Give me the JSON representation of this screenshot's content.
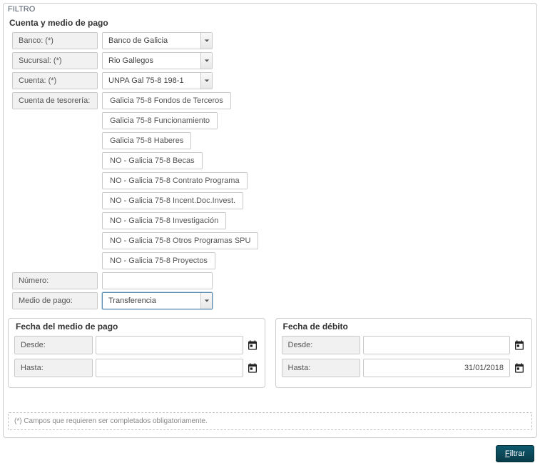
{
  "filter_title": "FILTRO",
  "sections": {
    "cuenta": {
      "title": "Cuenta y medio de pago",
      "banco_label": "Banco: (*)",
      "banco_value": "Banco de Galicia",
      "sucursal_label": "Sucursal: (*)",
      "sucursal_value": "Rio Gallegos",
      "cuenta_label": "Cuenta: (*)",
      "cuenta_value": "UNPA Gal 75-8 198-1",
      "tesoreria_label": "Cuenta de tesorería:",
      "tesoreria_items": [
        "Galicia 75-8 Fondos de Terceros",
        "Galicia 75-8 Funcionamiento",
        "Galicia 75-8 Haberes",
        "NO - Galicia 75-8 Becas",
        "NO - Galicia 75-8 Contrato Programa",
        "NO - Galicia 75-8 Incent.Doc.Invest.",
        "NO - Galicia 75-8 Investigación",
        "NO - Galicia 75-8 Otros Programas SPU",
        "NO - Galicia 75-8 Proyectos"
      ],
      "numero_label": "Número:",
      "numero_value": "",
      "medio_label": "Medio de pago:",
      "medio_value": "Transferencia"
    },
    "fecha_medio": {
      "title": "Fecha del medio de pago",
      "desde_label": "Desde:",
      "desde_value": "",
      "hasta_label": "Hasta:",
      "hasta_value": ""
    },
    "fecha_debito": {
      "title": "Fecha de débito",
      "desde_label": "Desde:",
      "desde_value": "",
      "hasta_label": "Hasta:",
      "hasta_value": "31/01/2018"
    }
  },
  "footnote": "(*) Campos que requieren ser completados obligatoriamente.",
  "action": {
    "filtrar": "Filtrar"
  }
}
